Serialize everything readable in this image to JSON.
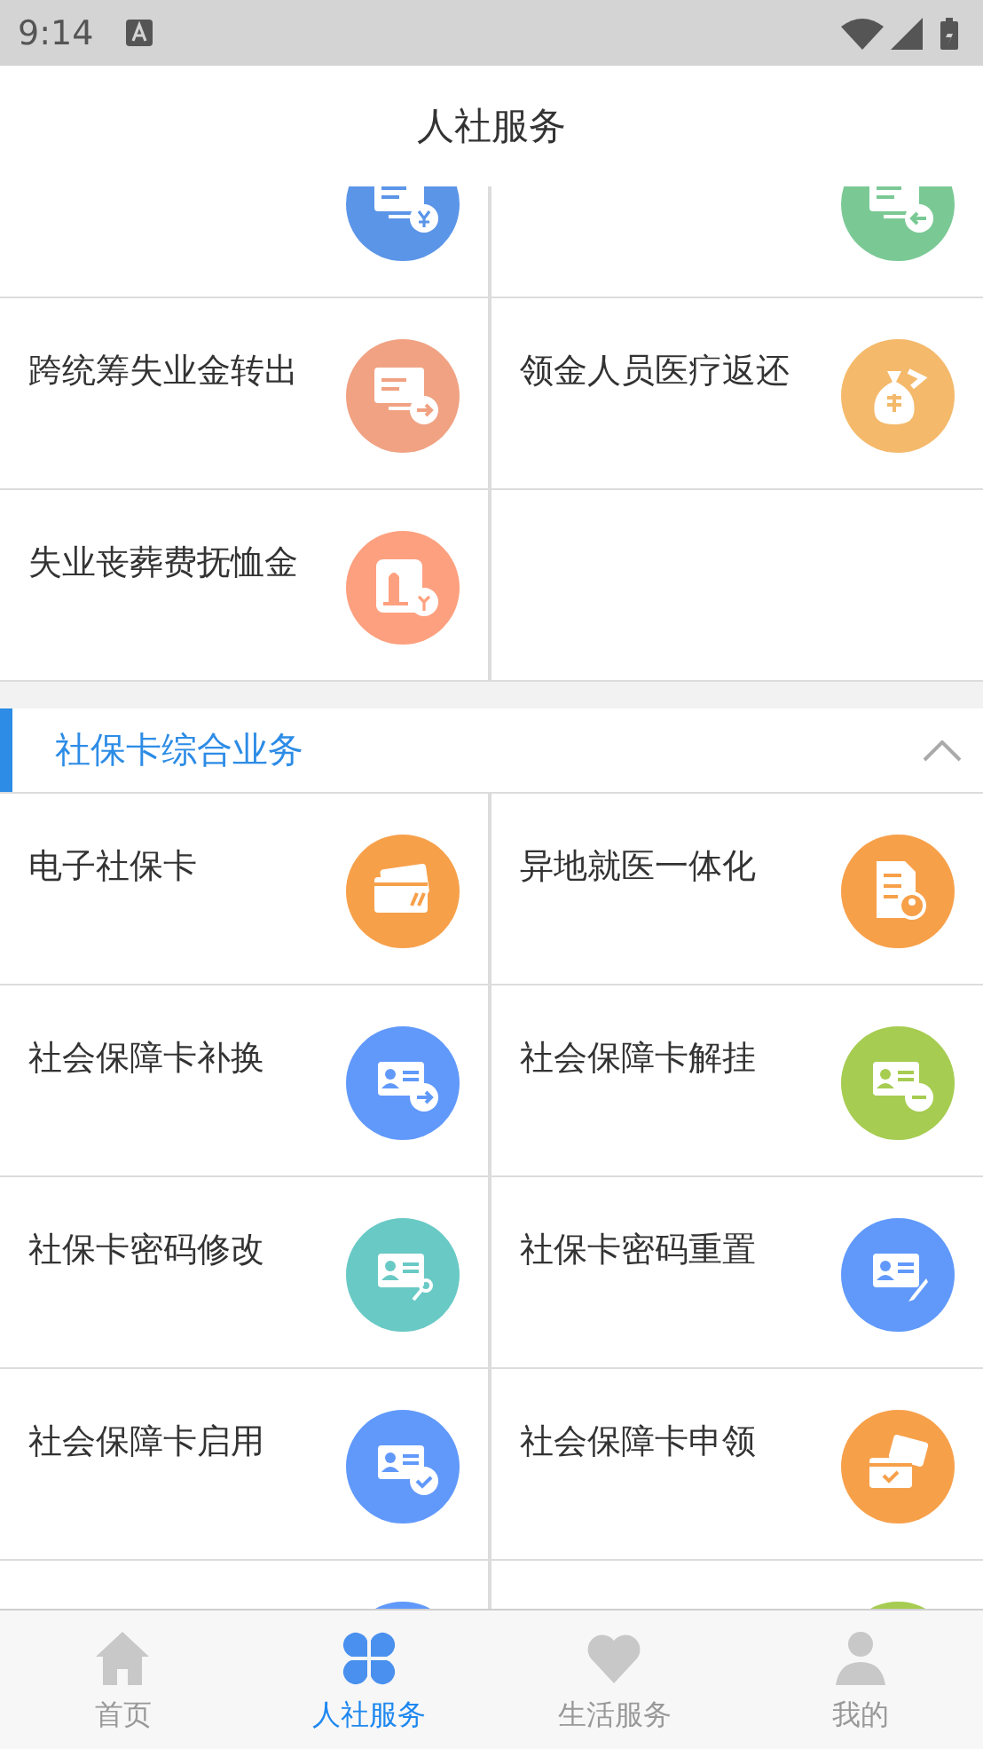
{
  "status_bar": {
    "time": "9:14"
  },
  "title": "人社服务",
  "sections": [
    {
      "tiles": [
        {
          "kind": "job-yen",
          "color": "#5b95e8"
        },
        {
          "kind": "job-back",
          "color": "#7ac995"
        },
        {
          "label": "跨统筹失业金转出",
          "kind": "job-out",
          "color": "#f0a283"
        },
        {
          "label": "领金人员医疗返还",
          "kind": "money-bag",
          "color": "#f4b96b"
        },
        {
          "label": "失业丧葬费抚恤金",
          "kind": "tomb-yen",
          "color": "#fda07f"
        }
      ]
    },
    {
      "header": {
        "title": "社保卡综合业务",
        "expanded": true
      },
      "tiles": [
        {
          "label": "电子社保卡",
          "kind": "si-card",
          "color": "#f7a04a"
        },
        {
          "label": "异地就医一体化",
          "kind": "doc-person",
          "color": "#f7a04a"
        },
        {
          "label": "社会保障卡补换",
          "kind": "card-arrow",
          "color": "#6199fb"
        },
        {
          "label": "社会保障卡解挂",
          "kind": "card-minus",
          "color": "#a6cc51"
        },
        {
          "label": "社保卡密码修改",
          "kind": "card-key",
          "color": "#69c9c5"
        },
        {
          "label": "社保卡密码重置",
          "kind": "card-pen",
          "color": "#6199fb"
        },
        {
          "label": "社会保障卡启用",
          "kind": "card-check",
          "color": "#6199fb"
        },
        {
          "label": "社会保障卡申领",
          "kind": "cards",
          "color": "#f7a04a"
        },
        {
          "kind": "card-plain",
          "color": "#6199fb"
        },
        {
          "kind": "card-plain",
          "color": "#a6cc51"
        }
      ]
    }
  ],
  "tabbar": [
    {
      "label": "首页",
      "kind": "home",
      "selected": false
    },
    {
      "label": "人社服务",
      "kind": "clover",
      "selected": true
    },
    {
      "label": "生活服务",
      "kind": "heart",
      "selected": false
    },
    {
      "label": "我的",
      "kind": "person",
      "selected": false
    }
  ]
}
